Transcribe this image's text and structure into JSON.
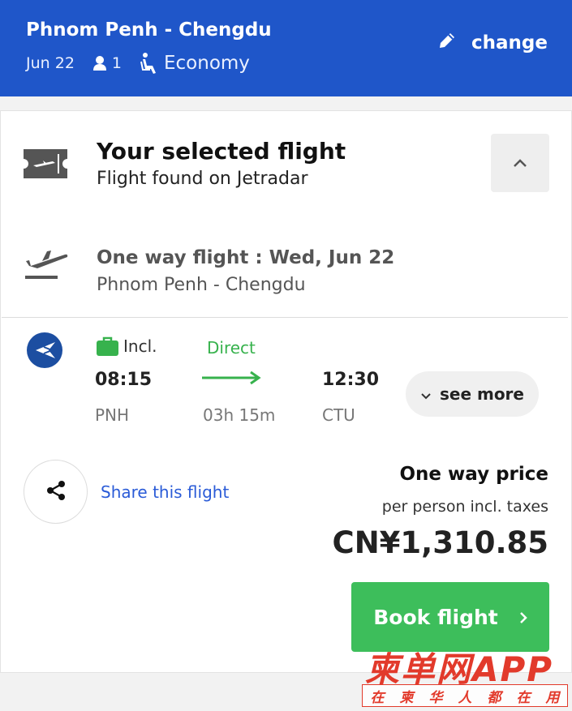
{
  "header": {
    "route": "Phnom Penh - Chengdu",
    "date": "Jun 22",
    "passengers": "1",
    "cabin": "Economy",
    "change_label": "change",
    "bg_color": "#1f56c9"
  },
  "selected": {
    "title": "Your selected flight",
    "subtitle": "Flight found on Jetradar"
  },
  "trip": {
    "title": "One way flight : Wed, Jun 22",
    "route": "Phnom Penh - Chengdu"
  },
  "segment": {
    "baggage": "Incl.",
    "stops": "Direct",
    "departure_time": "08:15",
    "arrival_time": "12:30",
    "departure_code": "PNH",
    "arrival_code": "CTU",
    "duration": "03h 15m",
    "see_more_label": "see more"
  },
  "share": {
    "label": "Share this flight"
  },
  "price": {
    "label": "One way price",
    "note": "per person incl. taxes",
    "amount": "CN¥1,310.85"
  },
  "book": {
    "label": "Book flight",
    "color": "#3dbe5b"
  },
  "watermark": {
    "main": "柬单网APP",
    "sub_chars": [
      "在",
      "柬",
      "华",
      "人",
      "都",
      "在",
      "用"
    ]
  },
  "icons": [
    "pencil-icon",
    "person-icon",
    "seat-icon",
    "ticket-icon",
    "chevron-up-icon",
    "takeoff-icon",
    "airline-logo",
    "suitcase-icon",
    "arrow-right-icon",
    "chevron-down-icon",
    "share-icon",
    "chevron-right-icon"
  ]
}
